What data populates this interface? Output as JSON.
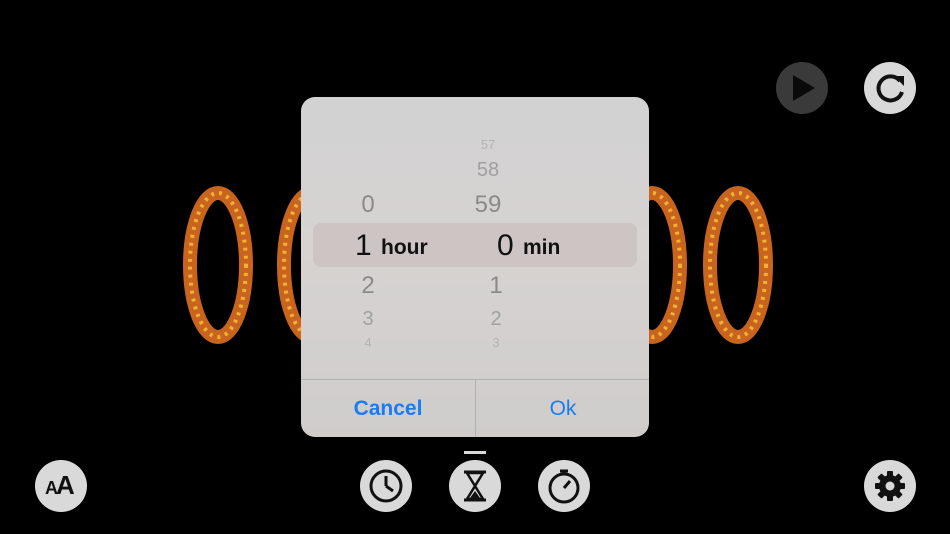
{
  "timer_display": {
    "digits": [
      "0",
      "0",
      "0",
      "0"
    ],
    "color": "#c8641e"
  },
  "picker": {
    "hours": {
      "above": [
        "0"
      ],
      "selected": "1",
      "below": [
        "2",
        "3",
        "4"
      ],
      "unit": "hour"
    },
    "minutes": {
      "above": [
        "57",
        "58",
        "59"
      ],
      "selected": "0",
      "below": [
        "1",
        "2",
        "3"
      ],
      "unit": "min"
    }
  },
  "dialog": {
    "cancel_label": "Cancel",
    "ok_label": "Ok",
    "accent": "#1a7cf5"
  },
  "toolbar": {
    "icons": [
      "play-icon",
      "reset-icon",
      "font-size-icon",
      "clock-icon",
      "hourglass-icon",
      "stopwatch-icon",
      "gear-icon"
    ],
    "active_mode": "hourglass-icon"
  }
}
